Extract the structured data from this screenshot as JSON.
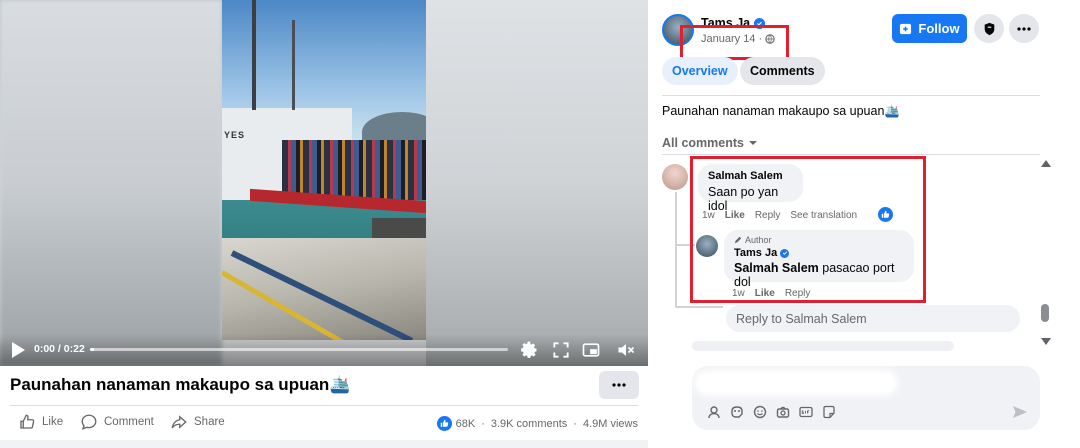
{
  "video": {
    "time_label": "0:00 / 0:22",
    "progress_fraction": 0.01,
    "frame_text": "YES"
  },
  "post": {
    "title": "Paunahan nanaman makaupo sa upuan🛳️",
    "actions": {
      "like": "Like",
      "comment": "Comment",
      "share": "Share"
    },
    "stats": {
      "reactions": "68K",
      "comments": "3.9K comments",
      "views": "4.9M views",
      "separator": "·"
    }
  },
  "author": {
    "name": "Tams Ja",
    "date": "January 14",
    "date_separator": "·",
    "follow_label": "Follow"
  },
  "tabs": [
    {
      "label": "Overview",
      "active": true
    },
    {
      "label": "Comments",
      "active": false
    }
  ],
  "caption": "Paunahan nanaman makaupo sa upuan🛳️",
  "all_comments_label": "All comments",
  "comments": [
    {
      "name": "Salmah Salem",
      "text": "Saan po yan idol",
      "time": "1w",
      "like": "Like",
      "reply": "Reply",
      "see_translation": "See translation"
    }
  ],
  "reply": {
    "author_badge": "Author",
    "name": "Tams Ja",
    "mention": "Salmah Salem",
    "text": " pasacao port dol",
    "time": "1w",
    "like": "Like",
    "reply": "Reply"
  },
  "reply_input_placeholder": "Reply to Salmah Salem",
  "colors": {
    "accent": "#1877f2",
    "highlight_box": "#e0202f",
    "bubble": "#f0f2f5"
  },
  "icons": [
    "play-icon",
    "settings-icon",
    "fullscreen-icon",
    "pip-icon",
    "mute-icon",
    "more-icon",
    "like-icon",
    "comment-icon",
    "share-icon",
    "globe-icon",
    "verified-icon",
    "shield-icon",
    "chevron-down-icon",
    "pencil-icon",
    "sticker-icon",
    "emoji-icon",
    "camera-icon",
    "gif-icon",
    "avatar-icon",
    "send-icon"
  ]
}
